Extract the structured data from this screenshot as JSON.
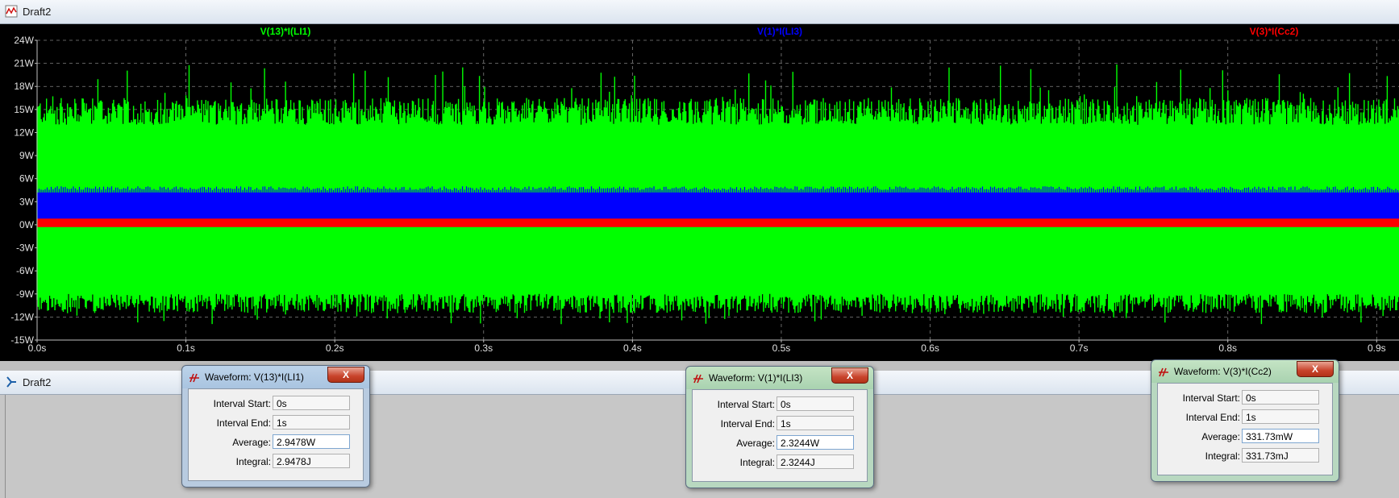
{
  "window_top": {
    "title": "Draft2"
  },
  "window_bottom": {
    "title": "Draft2"
  },
  "chart_data": {
    "type": "line",
    "y_ticks": [
      "24W",
      "21W",
      "18W",
      "15W",
      "12W",
      "9W",
      "6W",
      "3W",
      "0W",
      "-3W",
      "-6W",
      "-9W",
      "-12W",
      "-15W"
    ],
    "y_values": [
      24,
      21,
      18,
      15,
      12,
      9,
      6,
      3,
      0,
      -3,
      -6,
      -9,
      -12,
      -15
    ],
    "ylim": [
      -15,
      24
    ],
    "x_ticks": [
      "0.0s",
      "0.1s",
      "0.2s",
      "0.3s",
      "0.4s",
      "0.5s",
      "0.6s",
      "0.7s",
      "0.8s",
      "0.9s"
    ],
    "x_values": [
      0,
      0.1,
      0.2,
      0.3,
      0.4,
      0.5,
      0.6,
      0.7,
      0.8,
      0.9
    ],
    "xlim": [
      0,
      0.915
    ],
    "grid": true,
    "series": [
      {
        "name": "V(13)*I(LI1)",
        "color": "#00ff00",
        "band": [
          -10,
          15
        ],
        "spike_range": [
          -13,
          21
        ]
      },
      {
        "name": "V(1)*I(LI3)",
        "color": "#0000ff",
        "band": [
          0.5,
          4.5
        ]
      },
      {
        "name": "V(3)*I(Cc2)",
        "color": "#ff0000",
        "band": [
          -0.3,
          0.8
        ]
      }
    ]
  },
  "dialogs": [
    {
      "title": "Waveform: V(13)*I(LI1)",
      "close": "X",
      "color": "blue",
      "labels": {
        "start": "Interval Start:",
        "end": "Interval End:",
        "avg": "Average:",
        "integral": "Integral:"
      },
      "values": {
        "start": "0s",
        "end": "1s",
        "avg": "2.9478W",
        "integral": "2.9478J"
      }
    },
    {
      "title": "Waveform: V(1)*I(LI3)",
      "close": "X",
      "color": "green",
      "labels": {
        "start": "Interval Start:",
        "end": "Interval End:",
        "avg": "Average:",
        "integral": "Integral:"
      },
      "values": {
        "start": "0s",
        "end": "1s",
        "avg": "2.3244W",
        "integral": "2.3244J"
      }
    },
    {
      "title": "Waveform: V(3)*I(Cc2)",
      "close": "X",
      "color": "green",
      "labels": {
        "start": "Interval Start:",
        "end": "Interval End:",
        "avg": "Average:",
        "integral": "Integral:"
      },
      "values": {
        "start": "0s",
        "end": "1s",
        "avg": "331.73mW",
        "integral": "331.73mJ"
      }
    }
  ]
}
